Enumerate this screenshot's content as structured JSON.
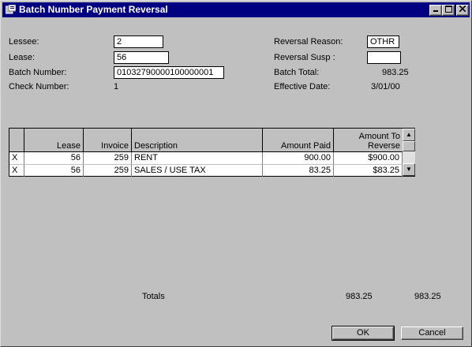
{
  "window": {
    "title": "Batch Number Payment Reversal",
    "minimize_icon": "minimize-icon",
    "maximize_icon": "maximize-icon",
    "close_icon": "close-icon"
  },
  "form": {
    "lessee_label": "Lessee:",
    "lessee_value": "2",
    "lease_label": "Lease:",
    "lease_value": "56",
    "batch_number_label": "Batch Number:",
    "batch_number_value": "01032790000100000001",
    "check_number_label": "Check Number:",
    "check_number_value": "1",
    "reversal_reason_label": "Reversal Reason:",
    "reversal_reason_value": "OTHR",
    "reversal_susp_label": "Reversal Susp  :",
    "reversal_susp_value": "",
    "batch_total_label": "Batch Total:",
    "batch_total_value": "983.25",
    "effective_date_label": "Effective Date:",
    "effective_date_value": "3/01/00"
  },
  "grid": {
    "headers": [
      "",
      "Lease",
      "Invoice",
      "Description",
      "Amount Paid",
      "Amount To Reverse"
    ],
    "header_reverse_line1": "Amount To",
    "header_reverse_line2": "Reverse",
    "rows": [
      {
        "mark": "X",
        "lease": "56",
        "invoice": "259",
        "description": "RENT",
        "amount_paid": "900.00",
        "amount_to_reverse": "$900.00"
      },
      {
        "mark": "X",
        "lease": "56",
        "invoice": "259",
        "description": "SALES / USE TAX",
        "amount_paid": "83.25",
        "amount_to_reverse": "$83.25"
      }
    ]
  },
  "totals": {
    "label": "Totals",
    "amount_paid_total": "983.25",
    "amount_to_reverse_total": "983.25"
  },
  "buttons": {
    "ok_label": "OK",
    "cancel_label": "Cancel"
  },
  "colors": {
    "titlebar": "#000080",
    "face": "#c0c0c0"
  }
}
